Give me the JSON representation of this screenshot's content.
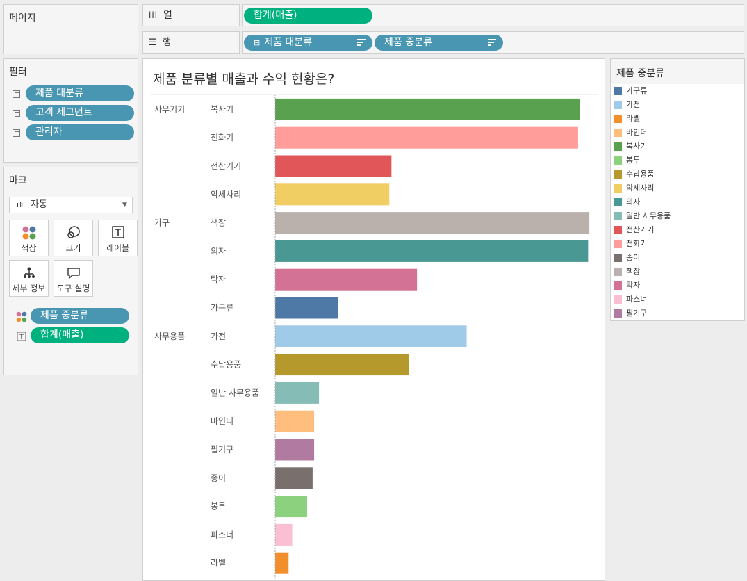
{
  "pages_title": "페이지",
  "columns_shelf": {
    "label": "열",
    "pill": "합계(매출)"
  },
  "rows_shelf": {
    "label": "행",
    "pills": [
      "제품 대분류",
      "제품 중분류"
    ]
  },
  "filters": {
    "title": "필터",
    "items": [
      "제품 대분류",
      "고객 세그먼트",
      "관리자"
    ]
  },
  "marks": {
    "title": "마크",
    "type": "자동",
    "buttons": [
      "색상",
      "크기",
      "레이블",
      "세부 정보",
      "도구 설명"
    ],
    "pills": [
      {
        "icon": "color-icon",
        "label": "제품 중분류"
      },
      {
        "icon": "text-icon",
        "label": "합계(매출)"
      }
    ]
  },
  "legend": {
    "title": "제품 중분류",
    "items": [
      {
        "label": "가구류",
        "color": "#4e79a7"
      },
      {
        "label": "가전",
        "color": "#a0cbe8"
      },
      {
        "label": "라벨",
        "color": "#f28e2b"
      },
      {
        "label": "바인더",
        "color": "#ffbe7d"
      },
      {
        "label": "복사기",
        "color": "#59a14f"
      },
      {
        "label": "봉투",
        "color": "#8cd17d"
      },
      {
        "label": "수납용품",
        "color": "#b6992d"
      },
      {
        "label": "악세사리",
        "color": "#f1ce63"
      },
      {
        "label": "의자",
        "color": "#499894"
      },
      {
        "label": "일반 사무용품",
        "color": "#86bcb6"
      },
      {
        "label": "전산기기",
        "color": "#e15759"
      },
      {
        "label": "전화기",
        "color": "#ff9d9a"
      },
      {
        "label": "종이",
        "color": "#79706e"
      },
      {
        "label": "책장",
        "color": "#bab0ac"
      },
      {
        "label": "탁자",
        "color": "#d37295"
      },
      {
        "label": "파스너",
        "color": "#fabfd2"
      },
      {
        "label": "필기구",
        "color": "#b07aa1"
      }
    ]
  },
  "chart_data": {
    "type": "bar",
    "title": "제품 분류별 매출과 수익 현황은?",
    "orientation": "horizontal",
    "groups": [
      {
        "name": "사무기기",
        "items": [
          {
            "label": "복사기",
            "value": 1000,
            "color": "#59a14f"
          },
          {
            "label": "전화기",
            "value": 995,
            "color": "#ff9d9a"
          },
          {
            "label": "전산기기",
            "value": 382,
            "color": "#e15759"
          },
          {
            "label": "악세사리",
            "value": 375,
            "color": "#f1ce63"
          }
        ]
      },
      {
        "name": "가구",
        "items": [
          {
            "label": "책장",
            "value": 1032,
            "color": "#bab0ac"
          },
          {
            "label": "의자",
            "value": 1028,
            "color": "#499894"
          },
          {
            "label": "탁자",
            "value": 466,
            "color": "#d37295"
          },
          {
            "label": "가구류",
            "value": 207,
            "color": "#4e79a7"
          }
        ]
      },
      {
        "name": "사무용품",
        "items": [
          {
            "label": "가전",
            "value": 629,
            "color": "#a0cbe8"
          },
          {
            "label": "수납용품",
            "value": 440,
            "color": "#b6992d"
          },
          {
            "label": "일반 사무용품",
            "value": 144,
            "color": "#86bcb6"
          },
          {
            "label": "바인더",
            "value": 128,
            "color": "#ffbe7d"
          },
          {
            "label": "필기구",
            "value": 128,
            "color": "#b07aa1"
          },
          {
            "label": "종이",
            "value": 123,
            "color": "#79706e"
          },
          {
            "label": "봉투",
            "value": 105,
            "color": "#8cd17d"
          },
          {
            "label": "파스너",
            "value": 56,
            "color": "#fabfd2"
          },
          {
            "label": "라벨",
            "value": 44,
            "color": "#f28e2b"
          }
        ]
      }
    ],
    "xmax": 1050
  }
}
